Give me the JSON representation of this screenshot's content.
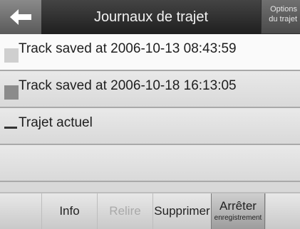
{
  "header": {
    "title": "Journaux de trajet",
    "options_line1": "Options",
    "options_line2": "du trajet"
  },
  "list": {
    "items": [
      {
        "label": "Track saved at 2006-10-13 08:43:59",
        "color": "#cfcfcf"
      },
      {
        "label": "Track saved at 2006-10-18 16:13:05",
        "color": "#8b8b8b"
      },
      {
        "label": "Trajet actuel"
      }
    ]
  },
  "footer": {
    "tabs": [
      {
        "label": "Info"
      },
      {
        "label": "Relire"
      },
      {
        "label": "Supprimer"
      },
      {
        "label": "Arrêter",
        "sub": "enregistrement"
      }
    ]
  },
  "icons": {
    "back": "arrow-left-icon"
  }
}
